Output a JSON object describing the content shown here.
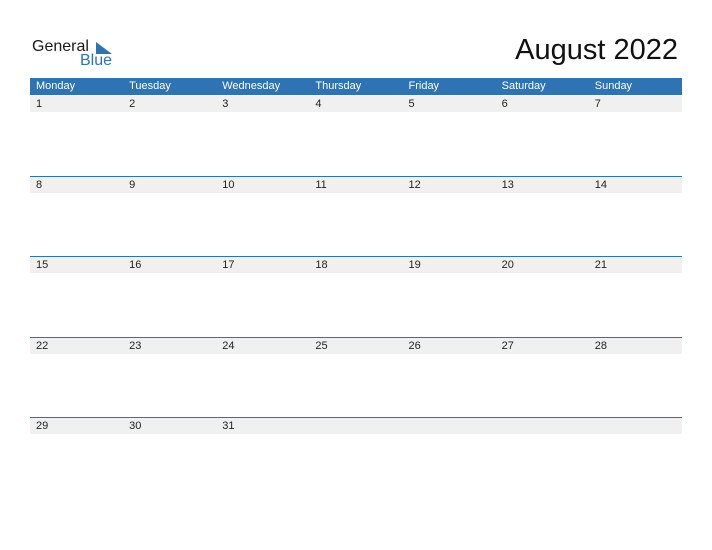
{
  "logo": {
    "general": "General",
    "blue": "Blue"
  },
  "title": "August 2022",
  "colors": {
    "accent": "#2e74b5",
    "strip": "#f0f0f0"
  },
  "days": [
    "Monday",
    "Tuesday",
    "Wednesday",
    "Thursday",
    "Friday",
    "Saturday",
    "Sunday"
  ],
  "weeks": [
    [
      "1",
      "2",
      "3",
      "4",
      "5",
      "6",
      "7"
    ],
    [
      "8",
      "9",
      "10",
      "11",
      "12",
      "13",
      "14"
    ],
    [
      "15",
      "16",
      "17",
      "18",
      "19",
      "20",
      "21"
    ],
    [
      "22",
      "23",
      "24",
      "25",
      "26",
      "27",
      "28"
    ],
    [
      "29",
      "30",
      "31",
      "",
      "",
      "",
      ""
    ]
  ]
}
